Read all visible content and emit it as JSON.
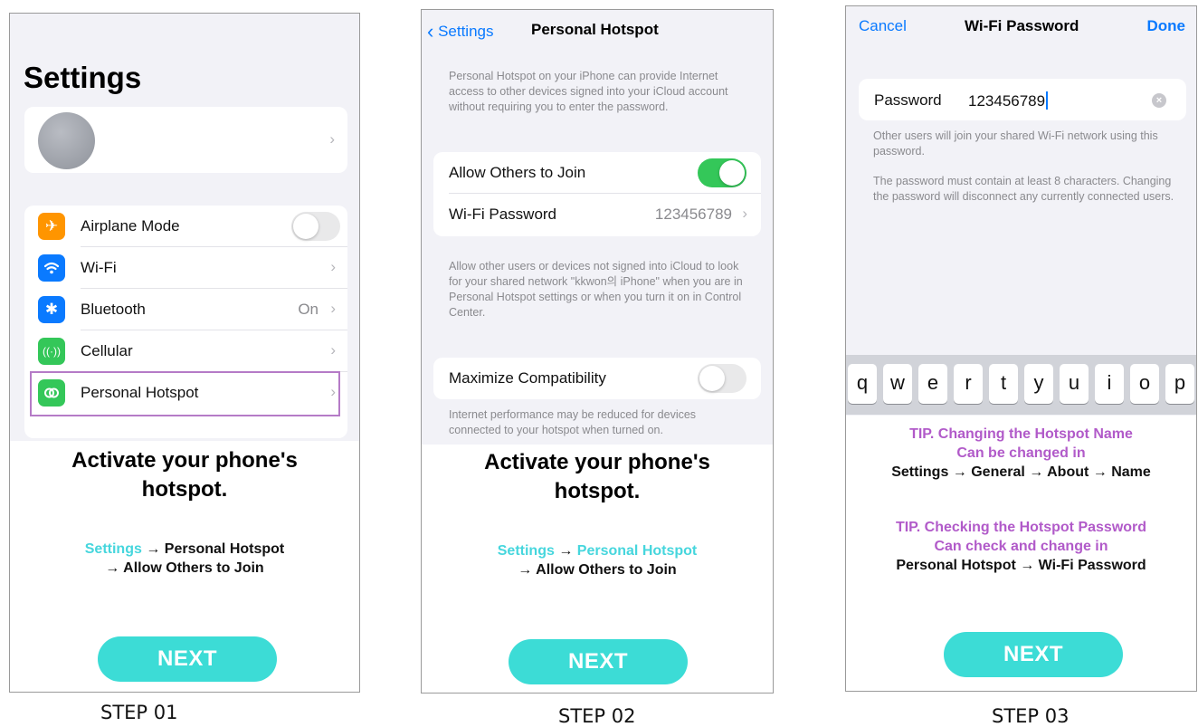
{
  "step1": {
    "title": "Settings",
    "rows": [
      {
        "label": "Airplane Mode",
        "icon": "airplane-icon",
        "color": "#ff9500"
      },
      {
        "label": "Wi-Fi",
        "icon": "wifi-icon",
        "color": "#0a7aff"
      },
      {
        "label": "Bluetooth",
        "icon": "bluetooth-icon",
        "color": "#0a7aff",
        "value": "On"
      },
      {
        "label": "Cellular",
        "icon": "cellular-icon",
        "color": "#34c759"
      },
      {
        "label": "Personal Hotspot",
        "icon": "hotspot-icon",
        "color": "#34c759"
      }
    ],
    "headline_line1": "Activate your phone's",
    "headline_line2": "hotspot.",
    "path_settings": "Settings",
    "path_arrow1": "→",
    "path_hotspot": "Personal Hotspot",
    "path_line2": "→ Allow Others to Join",
    "next_label": "NEXT",
    "step_label": "STEP 01"
  },
  "step2": {
    "back_label": "Settings",
    "title": "Personal Hotspot",
    "intro": "Personal Hotspot on your iPhone can provide Internet access to other devices signed into your iCloud account without requiring you to enter the password.",
    "allow_label": "Allow Others to Join",
    "wifi_password_label": "Wi-Fi Password",
    "wifi_password_value": "123456789",
    "allow_note": "Allow other users or devices not signed into iCloud to look for your shared network \"kkwon의 iPhone\" when you are in Personal Hotspot settings or when you turn it on in Control Center.",
    "maximize_label": "Maximize Compatibility",
    "maximize_note": "Internet performance may be reduced for devices connected to your hotspot when turned on.",
    "headline_line1": "Activate your phone's",
    "headline_line2": "hotspot.",
    "path_settings": "Settings",
    "path_arrow1": "→",
    "path_hotspot": "Personal Hotspot",
    "path_line2": "→ Allow Others to Join",
    "next_label": "NEXT",
    "step_label": "STEP 02"
  },
  "step3": {
    "cancel_label": "Cancel",
    "title": "Wi-Fi Password",
    "done_label": "Done",
    "password_label": "Password",
    "password_value": "123456789",
    "note1": "Other users will join your shared Wi-Fi network using this password.",
    "note2": "The password must contain at least 8 characters. Changing the password will disconnect any currently connected users.",
    "keys": [
      "q",
      "w",
      "e",
      "r",
      "t",
      "y",
      "u",
      "i",
      "o",
      "p"
    ],
    "tip1_line1": "TIP. Changing the Hotspot Name",
    "tip1_line2": "Can be changed in",
    "tip1_line3": "Settings → General → About → Name",
    "tip2_line1": "TIP. Checking the Hotspot Password",
    "tip2_line2": "Can check and change in",
    "tip2_line3": "Personal Hotspot → Wi-Fi Password",
    "next_label": "NEXT",
    "step_label": "STEP 03"
  },
  "colors": {
    "accent_cyan": "#3cdcd6",
    "tip_purple": "#b15ac9",
    "ios_blue": "#0a7aff",
    "toggle_green": "#34c759"
  }
}
